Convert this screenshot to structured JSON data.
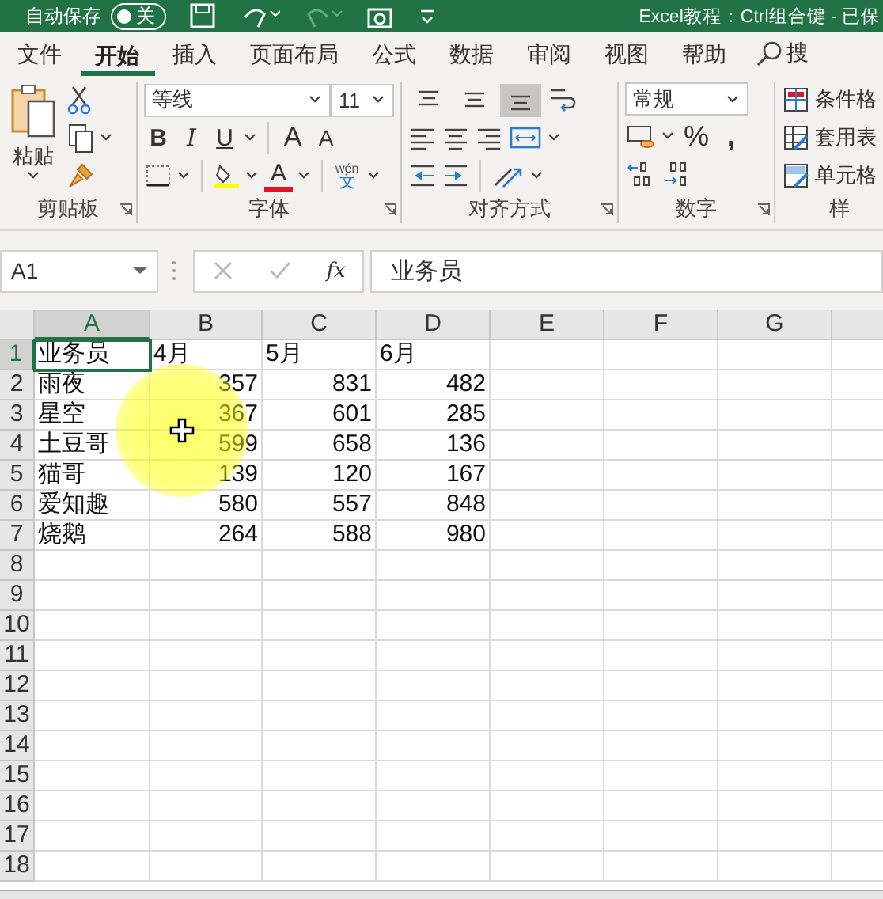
{
  "title_bar": {
    "autosave_label": "自动保存",
    "autosave_state": "关",
    "autosave_on": false,
    "document_title": "Excel教程：Ctrl组合键 - 已保"
  },
  "tabs": [
    {
      "label": "文件",
      "selected": false
    },
    {
      "label": "开始",
      "selected": true
    },
    {
      "label": "插入",
      "selected": false
    },
    {
      "label": "页面布局",
      "selected": false
    },
    {
      "label": "公式",
      "selected": false
    },
    {
      "label": "数据",
      "selected": false
    },
    {
      "label": "审阅",
      "selected": false
    },
    {
      "label": "视图",
      "selected": false
    },
    {
      "label": "帮助",
      "selected": false
    }
  ],
  "tell_me": "搜",
  "ribbon": {
    "paste_label": "粘贴",
    "font_name": "等线",
    "font_size": "11",
    "bold": "B",
    "italic": "I",
    "underline": "U",
    "grow_font": "A",
    "shrink_font": "A",
    "font_color": "A",
    "phonetic_top": "wén",
    "phonetic_bottom": "文",
    "vertical_align": [
      {
        "kind": "top",
        "selected": false
      },
      {
        "kind": "middle",
        "selected": false
      },
      {
        "kind": "bottom",
        "selected": true
      }
    ],
    "number_format": "常规",
    "percent": "%",
    "comma": ",",
    "styles": [
      "条件格",
      "套用表",
      "单元格"
    ],
    "group_labels": [
      "剪贴板",
      "字体",
      "对齐方式",
      "数字",
      "样"
    ]
  },
  "formula_bar": {
    "name_box": "A1",
    "fx": "fx",
    "content": "业务员"
  },
  "sheet": {
    "columns": [
      {
        "label": "A",
        "selected": true
      },
      {
        "label": "B",
        "selected": false
      },
      {
        "label": "C",
        "selected": false
      },
      {
        "label": "D",
        "selected": false
      },
      {
        "label": "E",
        "selected": false
      },
      {
        "label": "F",
        "selected": false
      },
      {
        "label": "G",
        "selected": false
      }
    ],
    "rows": [
      {
        "number": "1",
        "selected": true,
        "cells": [
          {
            "text": "业务员",
            "kind": "text",
            "selected": true
          },
          {
            "text": "4月",
            "kind": "text",
            "selected": false
          },
          {
            "text": "5月",
            "kind": "text",
            "selected": false
          },
          {
            "text": "6月",
            "kind": "text",
            "selected": false
          }
        ]
      },
      {
        "number": "2",
        "selected": false,
        "cells": [
          {
            "text": "雨夜",
            "kind": "text",
            "selected": false
          },
          {
            "text": "357",
            "kind": "number",
            "selected": false
          },
          {
            "text": "831",
            "kind": "number",
            "selected": false
          },
          {
            "text": "482",
            "kind": "number",
            "selected": false
          }
        ]
      },
      {
        "number": "3",
        "selected": false,
        "cells": [
          {
            "text": "星空",
            "kind": "text",
            "selected": false
          },
          {
            "text": "367",
            "kind": "number",
            "selected": false
          },
          {
            "text": "601",
            "kind": "number",
            "selected": false
          },
          {
            "text": "285",
            "kind": "number",
            "selected": false
          }
        ]
      },
      {
        "number": "4",
        "selected": false,
        "cells": [
          {
            "text": "土豆哥",
            "kind": "text",
            "selected": false
          },
          {
            "text": "599",
            "kind": "number",
            "selected": false
          },
          {
            "text": "658",
            "kind": "number",
            "selected": false
          },
          {
            "text": "136",
            "kind": "number",
            "selected": false
          }
        ]
      },
      {
        "number": "5",
        "selected": false,
        "cells": [
          {
            "text": "猫哥",
            "kind": "text",
            "selected": false
          },
          {
            "text": "139",
            "kind": "number",
            "selected": false
          },
          {
            "text": "120",
            "kind": "number",
            "selected": false
          },
          {
            "text": "167",
            "kind": "number",
            "selected": false
          }
        ]
      },
      {
        "number": "6",
        "selected": false,
        "cells": [
          {
            "text": "爱知趣",
            "kind": "text",
            "selected": false
          },
          {
            "text": "580",
            "kind": "number",
            "selected": false
          },
          {
            "text": "557",
            "kind": "number",
            "selected": false
          },
          {
            "text": "848",
            "kind": "number",
            "selected": false
          }
        ]
      },
      {
        "number": "7",
        "selected": false,
        "cells": [
          {
            "text": "烧鹅",
            "kind": "text",
            "selected": false
          },
          {
            "text": "264",
            "kind": "number",
            "selected": false
          },
          {
            "text": "588",
            "kind": "number",
            "selected": false
          },
          {
            "text": "980",
            "kind": "number",
            "selected": false
          }
        ]
      },
      {
        "number": "8",
        "selected": false,
        "cells": []
      },
      {
        "number": "9",
        "selected": false,
        "cells": []
      },
      {
        "number": "10",
        "selected": false,
        "cells": []
      },
      {
        "number": "11",
        "selected": false,
        "cells": []
      },
      {
        "number": "12",
        "selected": false,
        "cells": []
      },
      {
        "number": "13",
        "selected": false,
        "cells": []
      },
      {
        "number": "14",
        "selected": false,
        "cells": []
      },
      {
        "number": "15",
        "selected": false,
        "cells": []
      },
      {
        "number": "16",
        "selected": false,
        "cells": []
      },
      {
        "number": "17",
        "selected": false,
        "cells": []
      },
      {
        "number": "18",
        "selected": false,
        "cells": []
      }
    ]
  }
}
